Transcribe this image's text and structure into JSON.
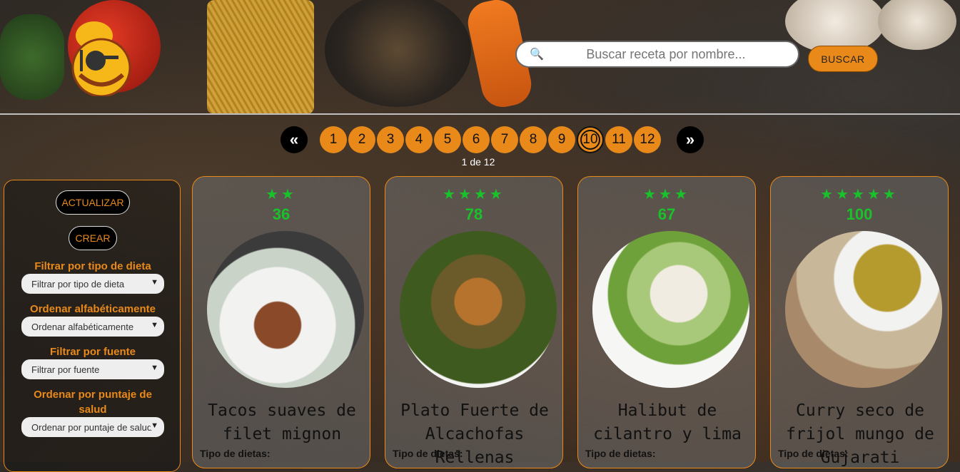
{
  "header": {
    "search_placeholder": "Buscar receta por nombre...",
    "search_button": "BUSCAR"
  },
  "pagination": {
    "prev": "«",
    "next": "»",
    "pages": [
      "1",
      "2",
      "3",
      "4",
      "5",
      "6",
      "7",
      "8",
      "9",
      "10",
      "11",
      "12"
    ],
    "current": "10",
    "info": "1 de 12"
  },
  "sidebar": {
    "refresh_button": "ACTUALIZAR",
    "create_button": "CREAR",
    "filters": [
      {
        "label": "Filtrar por tipo de dieta",
        "selected": "Filtrar por tipo de dieta"
      },
      {
        "label": "Ordenar alfabéticamente",
        "selected": "Ordenar alfabéticamente"
      },
      {
        "label": "Filtrar por fuente",
        "selected": "Filtrar por fuente"
      },
      {
        "label": "Ordenar por puntaje de salud",
        "selected": "Ordenar por puntaje de salud"
      }
    ]
  },
  "cards": [
    {
      "stars": "★★",
      "score": "36",
      "title": "Tacos suaves de filet mignon",
      "diets_label": "Tipo de dietas:"
    },
    {
      "stars": "★★★★",
      "score": "78",
      "title": "Plato Fuerte de Alcachofas Rellenas",
      "diets_label": "Tipo de dietas:"
    },
    {
      "stars": "★★★",
      "score": "67",
      "title": "Halibut de cilantro y lima",
      "diets_label": "Tipo de dietas:"
    },
    {
      "stars": "★★★★★",
      "score": "100",
      "title": "Curry seco de frijol mungo de Gujarati",
      "diets_label": "Tipo de dietas:"
    }
  ],
  "colors": {
    "accent": "#e8891a",
    "score_green": "#19c22a"
  }
}
